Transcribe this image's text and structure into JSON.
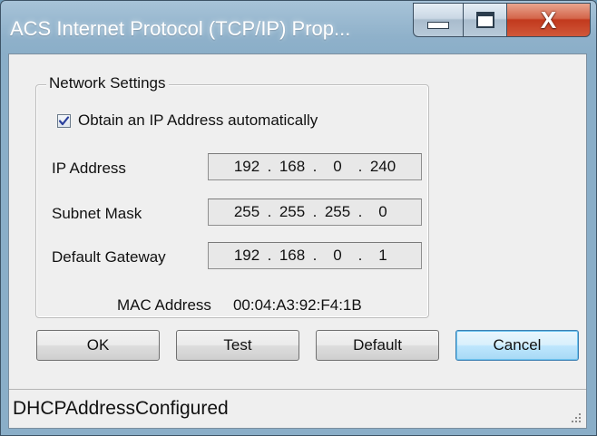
{
  "window": {
    "title": "ACS Internet Protocol (TCP/IP) Prop..."
  },
  "titlebar_buttons": {
    "minimize_icon": "minimize-icon",
    "maximize_icon": "maximize-icon",
    "close_icon": "close-icon",
    "close_glyph": "X"
  },
  "network_settings": {
    "group_label": "Network Settings",
    "auto_ip": {
      "label": "Obtain an IP Address automatically",
      "checked": true
    },
    "ip_address": {
      "label": "IP Address",
      "octets": [
        "192",
        "168",
        "0",
        "240"
      ]
    },
    "subnet_mask": {
      "label": "Subnet Mask",
      "octets": [
        "255",
        "255",
        "255",
        "0"
      ]
    },
    "default_gateway": {
      "label": "Default Gateway",
      "octets": [
        "192",
        "168",
        "0",
        "1"
      ]
    },
    "mac": {
      "label": "MAC Address",
      "value": "00:04:A3:92:F4:1B"
    }
  },
  "buttons": {
    "ok": "OK",
    "test": "Test",
    "default": "Default",
    "cancel": "Cancel"
  },
  "status": {
    "text": "DHCPAddressConfigured"
  },
  "colors": {
    "titlebar": "#8fb1ca",
    "close_button": "#c2391d",
    "dialog_background": "#efefef",
    "default_button_border": "#3c7fb1",
    "checkmark": "#2a3f9c"
  }
}
